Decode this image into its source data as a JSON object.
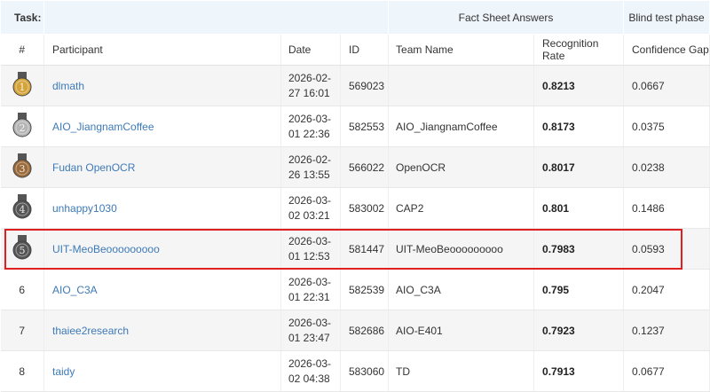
{
  "header": {
    "task_label": "Task:",
    "fact_sheet_label": "Fact Sheet Answers",
    "blind_test_label": "Blind test phase"
  },
  "columns": {
    "rank": "#",
    "participant": "Participant",
    "date": "Date",
    "id": "ID",
    "team_name": "Team Name",
    "recognition_rate": "Recognition Rate",
    "confidence_gap": "Confidence Gap"
  },
  "rows": [
    {
      "rank": "1",
      "medal": "gold",
      "participant": "dlmath",
      "date_line1": "2026-02-",
      "date_line2": "27 16:01",
      "id": "569023",
      "team": "",
      "rate": "0.8213",
      "gap": "0.0667"
    },
    {
      "rank": "2",
      "medal": "silver",
      "participant": "AIO_JiangnamCoffee",
      "date_line1": "2026-03-",
      "date_line2": "01 22:36",
      "id": "582553",
      "team": "AIO_JiangnamCoffee",
      "rate": "0.8173",
      "gap": "0.0375"
    },
    {
      "rank": "3",
      "medal": "bronze",
      "participant": "Fudan OpenOCR",
      "date_line1": "2026-02-",
      "date_line2": "26 13:55",
      "id": "566022",
      "team": "OpenOCR",
      "rate": "0.8017",
      "gap": "0.0238"
    },
    {
      "rank": "4",
      "medal": "dark",
      "participant": "unhappy1030",
      "date_line1": "2026-03-",
      "date_line2": "02 03:21",
      "id": "583002",
      "team": "CAP2",
      "rate": "0.801",
      "gap": "0.1486"
    },
    {
      "rank": "5",
      "medal": "dark",
      "participant": "UIT-MeoBeooooooooo",
      "date_line1": "2026-03-",
      "date_line2": "01 12:53",
      "id": "581447",
      "team": "UIT-MeoBeooooooooo",
      "rate": "0.7983",
      "gap": "0.0593"
    },
    {
      "rank": "6",
      "medal": "",
      "participant": "AIO_C3A",
      "date_line1": "2026-03-",
      "date_line2": "01 22:31",
      "id": "582539",
      "team": "AIO_C3A",
      "rate": "0.795",
      "gap": "0.2047"
    },
    {
      "rank": "7",
      "medal": "",
      "participant": "thaiee2research",
      "date_line1": "2026-03-",
      "date_line2": "01 23:47",
      "id": "582686",
      "team": "AIO-E401",
      "rate": "0.7923",
      "gap": "0.1237"
    },
    {
      "rank": "8",
      "medal": "",
      "participant": "taidy",
      "date_line1": "2026-03-",
      "date_line2": "02 04:38",
      "id": "583060",
      "team": "TD",
      "rate": "0.7913",
      "gap": "0.0677"
    }
  ],
  "highlighted_rank": "5",
  "colors": {
    "link": "#3d7ab8",
    "header_band": "#eef5fb",
    "highlight": "#e02020",
    "gold": "#d4a43a",
    "silver": "#b5b5b5",
    "bronze": "#9a6a3a",
    "dark": "#555555"
  }
}
